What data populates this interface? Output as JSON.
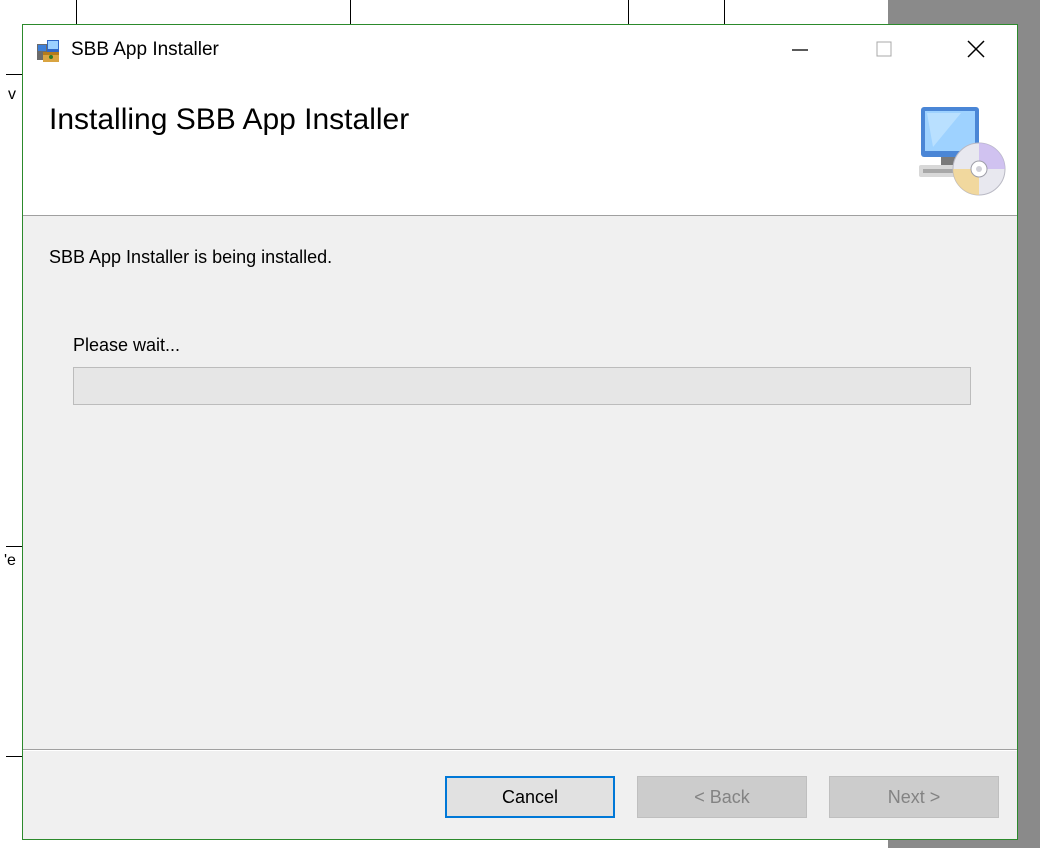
{
  "window": {
    "title": "SBB App Installer",
    "controls": {
      "minimize_icon": "minimize-icon",
      "maximize_icon": "maximize-icon",
      "close_icon": "close-icon"
    },
    "border_color": "#2c8a2c"
  },
  "banner": {
    "title": "Installing SBB App Installer",
    "icon": "computer-cd-icon"
  },
  "body": {
    "status": "SBB App Installer is being installed.",
    "wait_label": "Please wait...",
    "progress_percent": 0
  },
  "buttons": {
    "cancel": "Cancel",
    "back": "< Back",
    "next": "Next >"
  },
  "background": {
    "fragments": [
      "v",
      "'e"
    ]
  }
}
